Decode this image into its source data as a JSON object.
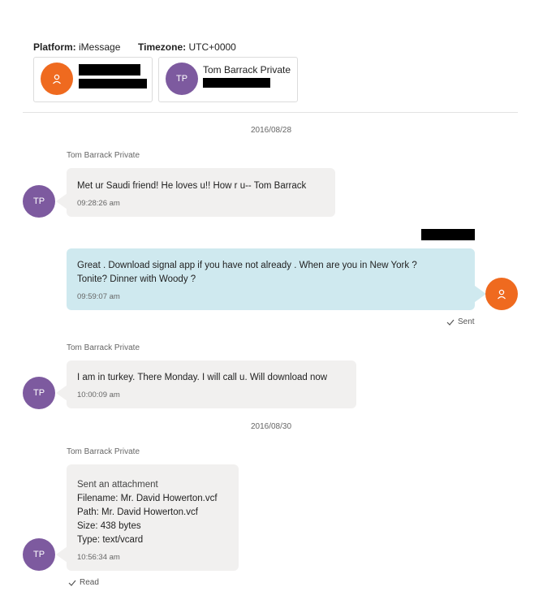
{
  "header": {
    "platform_label": "Platform:",
    "platform_value": "iMessage",
    "timezone_label": "Timezone:",
    "timezone_value": "UTC+0000"
  },
  "participants": [
    {
      "avatar_icon": "person-icon",
      "avatar_color": "#ef6a1f",
      "name": "[redacted]"
    },
    {
      "avatar_initials": "TP",
      "avatar_color": "#7d5a9f",
      "name": "Tom Barrack Private"
    }
  ],
  "dates": [
    "2016/08/28",
    "2016/08/30"
  ],
  "messages": [
    {
      "sender": "Tom Barrack Private",
      "avatar": "TP",
      "text": "Met ur Saudi friend!  He loves u!! How r u-- Tom Barrack",
      "time": "09:28:26 am"
    },
    {
      "sender": "[redacted]",
      "text_line1": "Great .  Download signal app if you have not already .  When are you in New York ?",
      "text_line2": "Tonite? Dinner with Woody ?",
      "time": "09:59:07 am",
      "status": "Sent"
    },
    {
      "sender": "Tom Barrack Private",
      "avatar": "TP",
      "text": "I am in turkey. There Monday. I will call u. Will download now",
      "time": "10:00:09 am"
    },
    {
      "sender": "Tom Barrack Private",
      "avatar": "TP",
      "attachment": {
        "title": "Sent an attachment",
        "filename": "Filename: Mr. David Howerton.vcf",
        "path": "Path: Mr. David Howerton.vcf",
        "size": "Size: 438 bytes",
        "type": "Type: text/vcard"
      },
      "time": "10:56:34 am",
      "status": "Read"
    }
  ]
}
